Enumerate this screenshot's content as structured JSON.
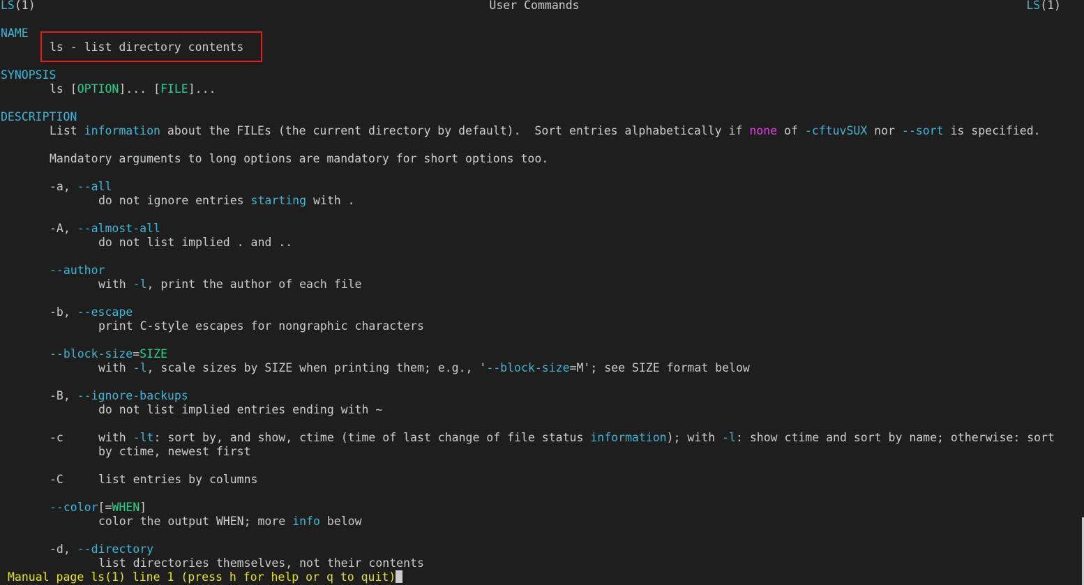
{
  "header": {
    "left_name": "LS",
    "left_section": "(1)",
    "center": "User Commands",
    "right_name": "LS",
    "right_section": "(1)"
  },
  "name_section": {
    "heading": "NAME",
    "text": "ls - list directory contents"
  },
  "synopsis_section": {
    "heading": "SYNOPSIS",
    "cmd": "ls",
    "open1": " [",
    "arg1": "OPTION",
    "close1": "]...",
    "open2": " [",
    "arg2": "FILE",
    "close2": "]..."
  },
  "description_section": {
    "heading": "DESCRIPTION",
    "p1": {
      "a": "List ",
      "b": "information",
      "c": " about the FILEs (the current directory by default).  Sort entries alphabetically if ",
      "d": "none",
      "e": " of ",
      "f": "-cftuvSUX",
      "g": " nor ",
      "h": "--sort",
      "i": " is specified."
    },
    "p2": "Mandatory arguments to long options are mandatory for short options too."
  },
  "options": {
    "all": {
      "short": "-a",
      "sep": ", ",
      "long": "--all",
      "desc_a": "do not ignore entries ",
      "desc_b": "starting",
      "desc_c": " with ."
    },
    "almost_all": {
      "short": "-A",
      "sep": ", ",
      "long": "--almost-all",
      "desc": "do not list implied . and .."
    },
    "author": {
      "long": "--author",
      "desc_a": "with ",
      "desc_b": "-l",
      "desc_c": ", print the author of each file"
    },
    "escape": {
      "short": "-b",
      "sep": ", ",
      "long": "--escape",
      "desc": "print C-style escapes for nongraphic characters"
    },
    "block_size": {
      "long": "--block-size",
      "eq": "=",
      "arg": "SIZE",
      "desc_a": "with ",
      "desc_b": "-l",
      "desc_c": ", scale sizes by SIZE when printing them; e.g., '",
      "desc_d": "--block-size",
      "desc_e": "=M'; see SIZE format below"
    },
    "ignore_backups": {
      "short": "-B",
      "sep": ", ",
      "long": "--ignore-backups",
      "desc": "do not list implied entries ending with ~"
    },
    "ctime": {
      "short": "-c",
      "desc_a": "with ",
      "desc_b": "-lt",
      "desc_c": ": sort by, and show, ctime (time of last change of file status ",
      "desc_d": "information",
      "desc_e": "); with ",
      "desc_f": "-l",
      "desc_g": ": show ctime and sort by name; otherwise: sort",
      "desc_cont": "by ctime, newest first"
    },
    "columns": {
      "short": "-C",
      "desc": "list entries by columns"
    },
    "color": {
      "long": "--color",
      "open": "[",
      "eq": "=",
      "arg": "WHEN",
      "close": "]",
      "desc_a": "color the output WHEN; more ",
      "desc_b": "info",
      "desc_c": " below"
    },
    "directory": {
      "short": "-d",
      "sep": ", ",
      "long": "--directory",
      "desc": "list directories themselves, not their contents"
    }
  },
  "status_bar": {
    "text": "Manual page ls(1) line 1 (press h for help or q to quit)"
  },
  "colors": {
    "background": "#1e1e1e",
    "text": "#cccccc",
    "cyan": "#3ab7d8",
    "green": "#23d18b",
    "magenta": "#e040e0",
    "yellow": "#e5e510",
    "highlight_box": "#e02020"
  }
}
